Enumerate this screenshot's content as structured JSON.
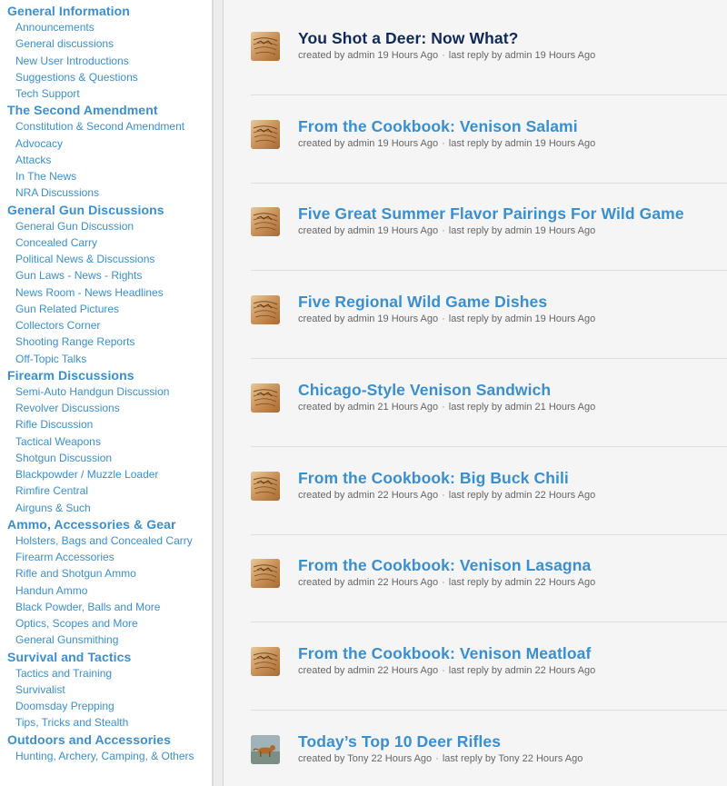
{
  "sidebar": {
    "categories": [
      {
        "title": "General Information",
        "items": [
          "Announcements",
          "General discussions",
          "New User Introductions",
          "Suggestions & Questions",
          "Tech Support"
        ]
      },
      {
        "title": "The Second Amendment",
        "items": [
          "Constitution & Second Amendment",
          "Advocacy",
          "Attacks",
          "In The News",
          "NRA Discussions"
        ]
      },
      {
        "title": "General Gun Discussions",
        "items": [
          "General Gun Discussion",
          "Concealed Carry",
          "Political News & Discussions",
          "Gun Laws - News - Rights",
          "News Room - News Headlines",
          "Gun Related Pictures",
          "Collectors Corner",
          "Shooting Range Reports",
          "Off-Topic Talks"
        ]
      },
      {
        "title": "Firearm Discussions",
        "items": [
          "Semi-Auto Handgun Discussion",
          "Revolver Discussions",
          "Rifle Discussion",
          "Tactical Weapons",
          "Shotgun Discussion",
          "Blackpowder / Muzzle Loader",
          "Rimfire Central",
          "Airguns & Such"
        ]
      },
      {
        "title": "Ammo, Accessories & Gear",
        "items": [
          "Holsters, Bags and Concealed Carry",
          "Firearm Accessories",
          "Rifle and Shotgun Ammo",
          "Handun Ammo",
          "Black Powder, Balls and More",
          "Optics, Scopes and More",
          "General Gunsmithing"
        ]
      },
      {
        "title": "Survival and Tactics",
        "items": [
          "Tactics and Training",
          "Survivalist",
          "Doomsday Prepping",
          "Tips, Tricks and Stealth"
        ]
      },
      {
        "title": "Outdoors and Accessories",
        "items": [
          "Hunting, Archery, Camping, & Others"
        ]
      }
    ]
  },
  "topics": [
    {
      "title": "You Shot a Deer: Now What?",
      "created_by": "created by admin 19 Hours Ago",
      "last_reply": "last reply by admin 19 Hours Ago",
      "avatar": "scroll-avatar",
      "visited": true
    },
    {
      "title": "From the Cookbook: Venison Salami",
      "created_by": "created by admin 19 Hours Ago",
      "last_reply": "last reply by admin 19 Hours Ago",
      "avatar": "scroll-avatar",
      "visited": false
    },
    {
      "title": "Five Great Summer Flavor Pairings For Wild Game",
      "created_by": "created by admin 19 Hours Ago",
      "last_reply": "last reply by admin 19 Hours Ago",
      "avatar": "scroll-avatar",
      "visited": false
    },
    {
      "title": "Five Regional Wild Game Dishes",
      "created_by": "created by admin 19 Hours Ago",
      "last_reply": "last reply by admin 19 Hours Ago",
      "avatar": "scroll-avatar",
      "visited": false
    },
    {
      "title": "Chicago-Style Venison Sandwich",
      "created_by": "created by admin 21 Hours Ago",
      "last_reply": "last reply by admin 21 Hours Ago",
      "avatar": "scroll-avatar",
      "visited": false
    },
    {
      "title": "From the Cookbook: Big Buck Chili",
      "created_by": "created by admin 22 Hours Ago",
      "last_reply": "last reply by admin 22 Hours Ago",
      "avatar": "scroll-avatar",
      "visited": false
    },
    {
      "title": "From the Cookbook: Venison Lasagna",
      "created_by": "created by admin 22 Hours Ago",
      "last_reply": "last reply by admin 22 Hours Ago",
      "avatar": "scroll-avatar",
      "visited": false
    },
    {
      "title": "From the Cookbook: Venison Meatloaf",
      "created_by": "created by admin 22 Hours Ago",
      "last_reply": "last reply by admin 22 Hours Ago",
      "avatar": "scroll-avatar",
      "visited": false
    },
    {
      "title": "Today’s Top 10 Deer Rifles",
      "created_by": "created by Tony 22 Hours Ago",
      "last_reply": "last reply by Tony 22 Hours Ago",
      "avatar": "dog-photo-avatar",
      "visited": false
    }
  ],
  "meta_separator": "·",
  "colors": {
    "link": "#3a8fd0",
    "visited_title": "#0f2a5a",
    "meta": "#666666",
    "background": "#f5f5f5"
  }
}
